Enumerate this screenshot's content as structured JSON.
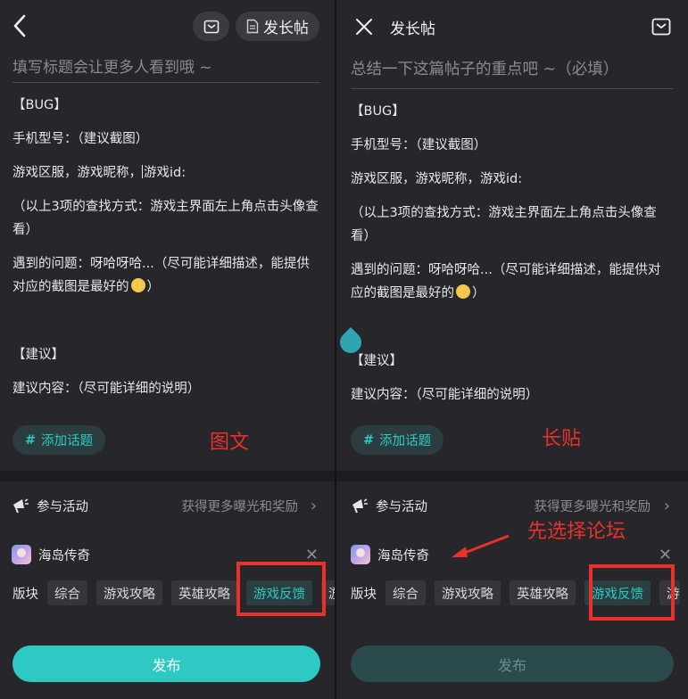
{
  "left": {
    "long_post_label": "发长帖",
    "title_placeholder": "填写标题会让更多人看到哦 ~",
    "body_lines": {
      "bug": "【BUG】",
      "phone": "手机型号：（建议截图）",
      "server_a": "游戏区服，游戏昵称，",
      "server_b": "游戏id:",
      "lookup": "（以上3项的查找方式：游戏主界面左上角点击头像查看）",
      "problem": "遇到的问题：呀哈呀哈...（尽可能详细描述，能提供对应的截图是最好的",
      "problem_end": "）",
      "suggest": "【建议】",
      "suggest_content": "建议内容：（尽可能详细的说明）"
    },
    "topic_hash": "#",
    "topic_label": "添加话题",
    "annotation": "图文",
    "activity_label": "参与活动",
    "activity_hint": "获得更多曝光和奖励",
    "forum_name": "海岛传奇",
    "board_label": "版块",
    "boards": [
      "综合",
      "游戏攻略",
      "英雄攻略",
      "游戏反馈",
      "游"
    ],
    "publish_label": "发布"
  },
  "right": {
    "header_title": "发长帖",
    "summary_placeholder": "总结一下这篇帖子的重点吧 ~（必填）",
    "body_lines": {
      "bug": "【BUG】",
      "phone": "手机型号：（建议截图）",
      "server": "游戏区服，游戏昵称，游戏id:",
      "lookup": "（以上3项的查找方式：游戏主界面左上角点击头像查看）",
      "problem": "遇到的问题：呀哈呀哈...（尽可能详细描述，能提供对应的截图是最好的",
      "problem_end": "）",
      "suggest": "【建议】",
      "suggest_content": "建议内容：（尽可能详细的说明）"
    },
    "topic_hash": "#",
    "topic_label": "添加话题",
    "annotation": "长贴",
    "forum_annotation": "先选择论坛",
    "activity_label": "参与活动",
    "activity_hint": "获得更多曝光和奖励",
    "forum_name": "海岛传奇",
    "board_label": "版块",
    "boards": [
      "综合",
      "游戏攻略",
      "英雄攻略",
      "游戏反馈",
      "游"
    ],
    "publish_label": "发布"
  },
  "colors": {
    "accent": "#2ec9c3",
    "annotation_red": "#e8312a",
    "background": "#26262b"
  },
  "icons": {
    "back": "chevron-left-icon",
    "close": "close-icon",
    "draft": "draft-box-icon",
    "document": "document-icon",
    "activity": "megaphone-icon",
    "chevron_right": "chevron-right-icon",
    "emoji": "emoji-icon"
  }
}
